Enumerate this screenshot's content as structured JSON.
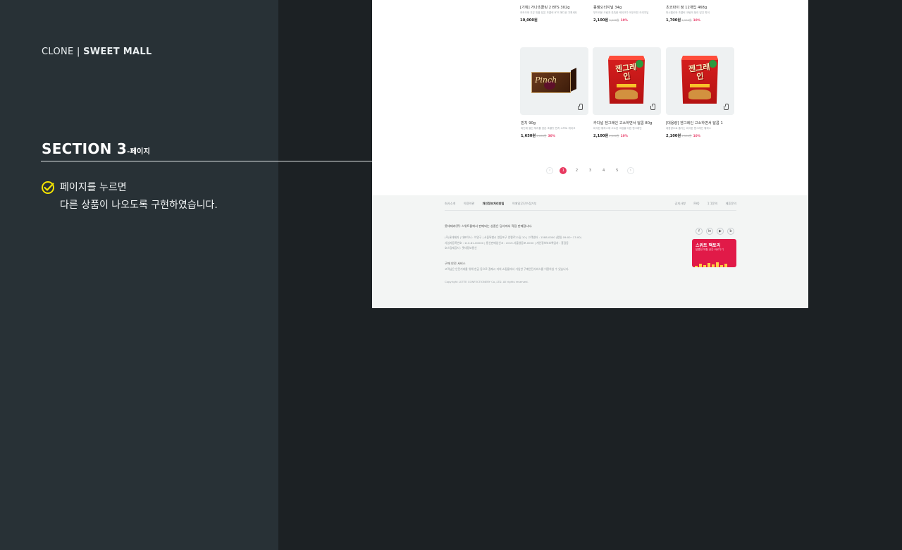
{
  "brand": {
    "prefix": "CLONE |",
    "name": "SWEET MALL"
  },
  "section": {
    "title": "SECTION 3",
    "suffix": "-페이지"
  },
  "description": {
    "line1": "페이지를 누르면",
    "line2": "다른 상품이 나오도록 구현하였습니다."
  },
  "colors": {
    "accent": "#e8385f",
    "check": "#f5e400"
  },
  "products_top": [
    {
      "name": "[기획] 가나초콜릿 2 BTS 302g",
      "desc": "카카오와 우유 맛을 담은 초콜릿 BTS 에디션 기획세트",
      "price": "10,000원",
      "old": "",
      "discount": ""
    },
    {
      "name": "몽쉘오리지널 34g",
      "desc": "부드러운 크림과 촉촉한 케이크가 어우러진 오리지널",
      "price": "2,100원",
      "old": "3,000원",
      "discount": "10%"
    },
    {
      "name": "초코파이 정 12개입 468g",
      "desc": "마시멜로와 초콜릿 코팅의 정이 담긴 파이",
      "price": "1,700원",
      "old": "1,900원",
      "discount": "10%"
    }
  ],
  "products_bottom": [
    {
      "name": "핀치 90g",
      "desc": "와인에 절인 체리를 담은 초콜릿 핀치 소프트 케이크",
      "price": "1,650원",
      "old": "2,000원",
      "discount": "30%",
      "image": "pinch-box",
      "image_label": "Pinch"
    },
    {
      "name": "카디널 젠그레인 고소하면서 달콤 80g",
      "desc": "바삭한 웨하스에 고소한 크림을 더한 젠그레인",
      "price": "2,100원",
      "old": "2,500원",
      "discount": "10%",
      "image": "zengrain-bag",
      "image_label": "젠그레인"
    },
    {
      "name": "[대용량] 젠그레인 고소하면서 달콤 1",
      "desc": "대용량으로 즐기는 바삭한 젠그레인 웨하스",
      "price": "2,100원",
      "old": "2,500원",
      "discount": "10%",
      "image": "zengrain-bag",
      "image_label": "젠그레인"
    }
  ],
  "pagination": {
    "prev": "‹",
    "next": "›",
    "pages": [
      "1",
      "2",
      "3",
      "4",
      "5"
    ],
    "active": "1"
  },
  "footer": {
    "nav_left": [
      "회사소개",
      "이용약관",
      "개인정보처리방침",
      "이메일무단수집거부"
    ],
    "nav_left_strong": "개인정보처리방침",
    "nav_right": [
      "공지사항",
      "FAQ",
      "1:1문의",
      "제휴문의"
    ],
    "company": "롯데제과(주) 스위트몰에서 판매되는 상품은 당사에서 직접 판매합니다.",
    "info1": "(주)롯데제과 | 대표이사 : 이영구 | 서울특별시 영등포구 양평로21길 10 | 고객센터 : 1588-0000 (평일 09:00~17:00)",
    "info2": "사업자등록번호 : 110-81-00000 | 통신판매업신고 : 2019-서울영등포-0000 | 개인정보보호책임자 : 홍길동",
    "info3": "호스팅제공자 : 롯데정보통신",
    "notice_title": "구매 안전 서비스",
    "notice": "고객님은 안전거래를 위해 현금 등으로 결제시 저희 쇼핑몰에서 가입한 구매안전서비스를 이용하실 수 있습니다.",
    "copyright": "Copyright LOTTE CONFECTIONERY Co.,LTD. All rights reserved.",
    "social": [
      "f",
      "in",
      "▶",
      "b"
    ],
    "banner_title": "스위트 팩토리",
    "banner_sub": "달콤한 체험 공간 바로가기"
  }
}
